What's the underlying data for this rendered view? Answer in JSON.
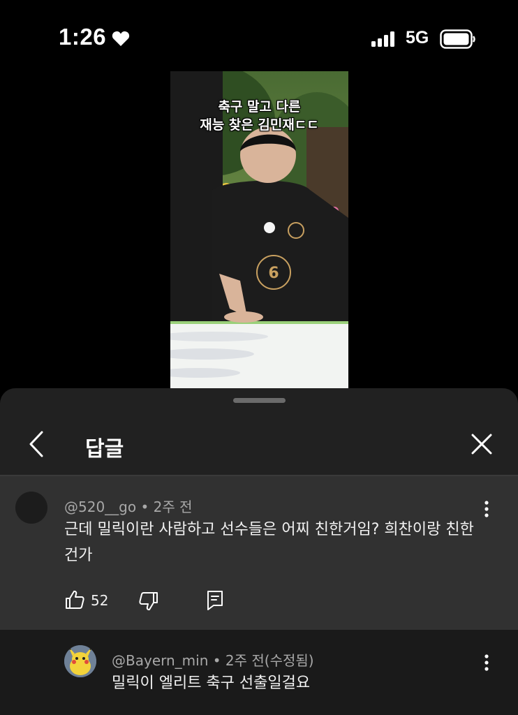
{
  "status_bar": {
    "time": "1:26",
    "network": "5G",
    "icons": [
      "heart-icon",
      "signal-icon",
      "battery-icon"
    ]
  },
  "video": {
    "caption_line1": "축구 말고 다른",
    "caption_line2": "재능 찾은 김민재ㄷㄷ"
  },
  "sheet": {
    "title": "답글",
    "icons": [
      "back-icon",
      "close-icon"
    ]
  },
  "comment": {
    "author": "@520__go",
    "time": "2주 전",
    "text": "근데 밀릭이란 사람하고 선수들은 어찌 친한거임? 희찬이랑 친한건가",
    "likes": "52"
  },
  "reply": {
    "author": "@Bayern_min",
    "time": "2주 전(수정됨)",
    "text": "밀릭이 엘리트 축구 선출일걸요"
  },
  "colors": {
    "background": "#000000",
    "sheet": "#212121",
    "highlight_comment": "#313131",
    "meta_text": "#a8a8a8"
  }
}
